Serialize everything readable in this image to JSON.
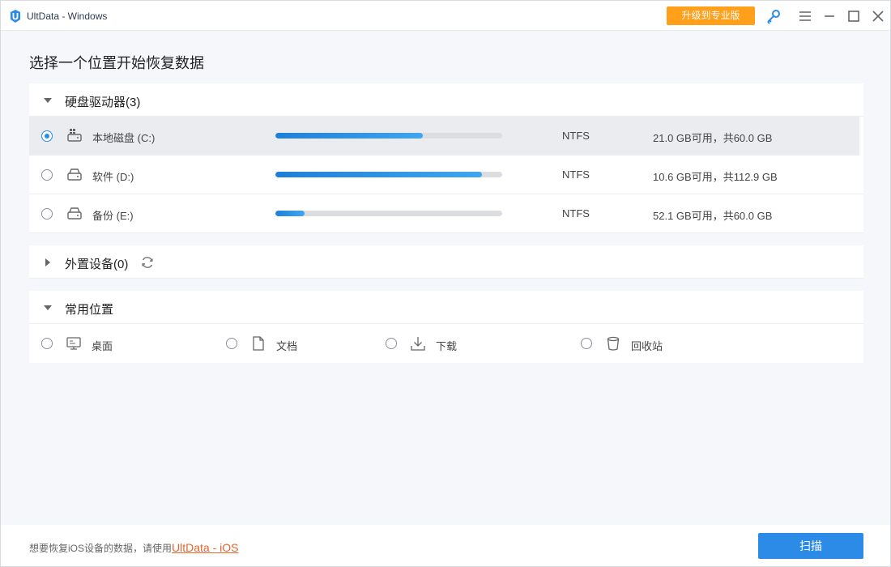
{
  "window": {
    "title": "UltData - Windows",
    "upgrade_label": "升级到专业版"
  },
  "page_title": "选择一个位置开始恢复数据",
  "sections": {
    "hard_drives": {
      "label": "硬盘驱动器(3)",
      "expanded": true,
      "drives": [
        {
          "name": "本地磁盘 (C:)",
          "fs": "NTFS",
          "size_text": "21.0 GB可用，共60.0 GB",
          "used_fraction": 0.65,
          "selected": true
        },
        {
          "name": "软件 (D:)",
          "fs": "NTFS",
          "size_text": "10.6 GB可用，共112.9 GB",
          "used_fraction": 0.91,
          "selected": false
        },
        {
          "name": "备份 (E:)",
          "fs": "NTFS",
          "size_text": "52.1 GB可用，共60.0 GB",
          "used_fraction": 0.13,
          "selected": false
        }
      ]
    },
    "external": {
      "label": "外置设备(0)",
      "expanded": false
    },
    "common": {
      "label": "常用位置",
      "expanded": true,
      "locations": [
        {
          "label": "桌面",
          "icon": "monitor-icon"
        },
        {
          "label": "文档",
          "icon": "document-icon"
        },
        {
          "label": "下载",
          "icon": "download-icon"
        },
        {
          "label": "回收站",
          "icon": "recycle-bin-icon"
        }
      ]
    }
  },
  "footer": {
    "note": "想要恢复iOS设备的数据，请使用",
    "link": "UltData - iOS",
    "scan_label": "扫描"
  },
  "colors": {
    "accent": "#2b8be6",
    "upgrade": "#ff9f1a",
    "link": "#e8642c"
  }
}
